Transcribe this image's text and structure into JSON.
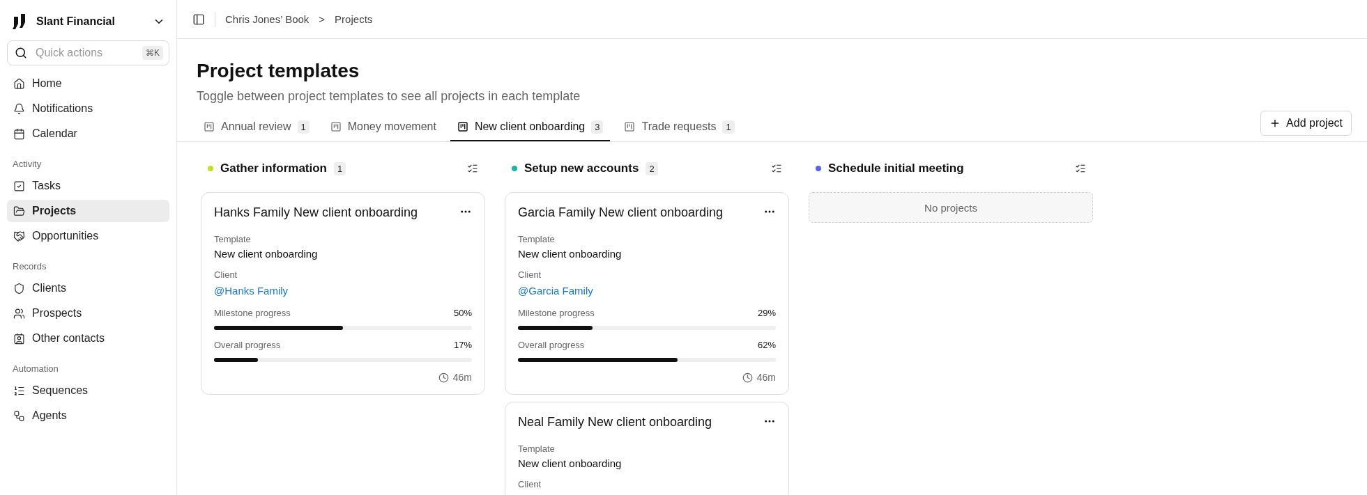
{
  "sidebar": {
    "brand": "Slant Financial",
    "search": {
      "placeholder": "Quick actions",
      "shortcut": "⌘K"
    },
    "sections": [
      {
        "items": [
          {
            "label": "Home",
            "selected": false
          },
          {
            "label": "Notifications",
            "selected": false
          },
          {
            "label": "Calendar",
            "selected": false
          }
        ]
      },
      {
        "title": "Activity",
        "items": [
          {
            "label": "Tasks",
            "selected": false
          },
          {
            "label": "Projects",
            "selected": true
          },
          {
            "label": "Opportunities",
            "selected": false
          }
        ]
      },
      {
        "title": "Records",
        "items": [
          {
            "label": "Clients",
            "selected": false
          },
          {
            "label": "Prospects",
            "selected": false
          },
          {
            "label": "Other contacts",
            "selected": false
          }
        ]
      },
      {
        "title": "Automation",
        "items": [
          {
            "label": "Sequences",
            "selected": false
          },
          {
            "label": "Agents",
            "selected": false
          }
        ]
      }
    ]
  },
  "breadcrumb": [
    "Chris Jones’ Book",
    ">",
    "Projects"
  ],
  "page": {
    "title": "Project templates",
    "subtitle": "Toggle between project templates to see all projects in each template"
  },
  "tabs": [
    {
      "label": "Annual review",
      "count": "1",
      "selected": false
    },
    {
      "label": "Money movement",
      "selected": false
    },
    {
      "label": "New client onboarding",
      "count": "3",
      "selected": true
    },
    {
      "label": "Trade requests",
      "count": "1",
      "selected": false
    }
  ],
  "add_button": "Add project",
  "columns": [
    {
      "title": "Gather information",
      "count": "1",
      "color": "#c6e01b",
      "cards": [
        {
          "title": "Hanks Family New client onboarding",
          "template_label": "Template",
          "template": "New client onboarding",
          "client_label": "Client",
          "client": "@Hanks Family",
          "progress": [
            {
              "label": "Milestone progress",
              "reading": "50%",
              "level": 0.5
            },
            {
              "label": "Overall progress",
              "reading": "17%",
              "level": 0.17
            }
          ],
          "time": "46m"
        }
      ]
    },
    {
      "title": "Setup new accounts",
      "count": "2",
      "color": "#1fb3a6",
      "cards": [
        {
          "title": "Garcia Family New client onboarding",
          "template_label": "Template",
          "template": "New client onboarding",
          "client_label": "Client",
          "client": "@Garcia Family",
          "progress": [
            {
              "label": "Milestone progress",
              "reading": "29%",
              "level": 0.29
            },
            {
              "label": "Overall progress",
              "reading": "62%",
              "level": 0.62
            }
          ],
          "time": "46m"
        },
        {
          "title": "Neal Family New client onboarding",
          "template_label": "Template",
          "template": "New client onboarding",
          "client_label": "Client"
        }
      ]
    },
    {
      "title": "Schedule initial meeting",
      "color": "#5b63f0",
      "empty": "No projects"
    }
  ]
}
